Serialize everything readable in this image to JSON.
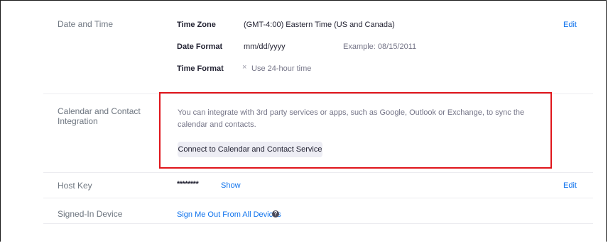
{
  "date_time": {
    "label": "Date and Time",
    "time_zone_label": "Time Zone",
    "time_zone_value": "(GMT-4:00) Eastern Time (US and Canada)",
    "edit_label": "Edit",
    "date_format_label": "Date Format",
    "date_format_value": "mm/dd/yyyy",
    "date_format_example": "Example: 08/15/2011",
    "time_format_label": "Time Format",
    "time_format_value": "Use 24-hour time"
  },
  "calendar": {
    "label": "Calendar and Contact Integration",
    "description": "You can integrate with 3rd party services or apps, such as Google, Outlook or Exchange, to sync the calendar and contacts.",
    "button_label": "Connect to Calendar and Contact Service"
  },
  "host_key": {
    "label": "Host Key",
    "masked_value": "********",
    "show_label": "Show",
    "edit_label": "Edit"
  },
  "signed_in": {
    "label": "Signed-In Device",
    "link_label": "Sign Me Out From All Devices"
  },
  "icons": {
    "info": "info-icon",
    "close": "x-icon"
  },
  "colors": {
    "link": "#0e72ed",
    "highlight": "#e0151b",
    "button_bg": "#ededf4"
  }
}
